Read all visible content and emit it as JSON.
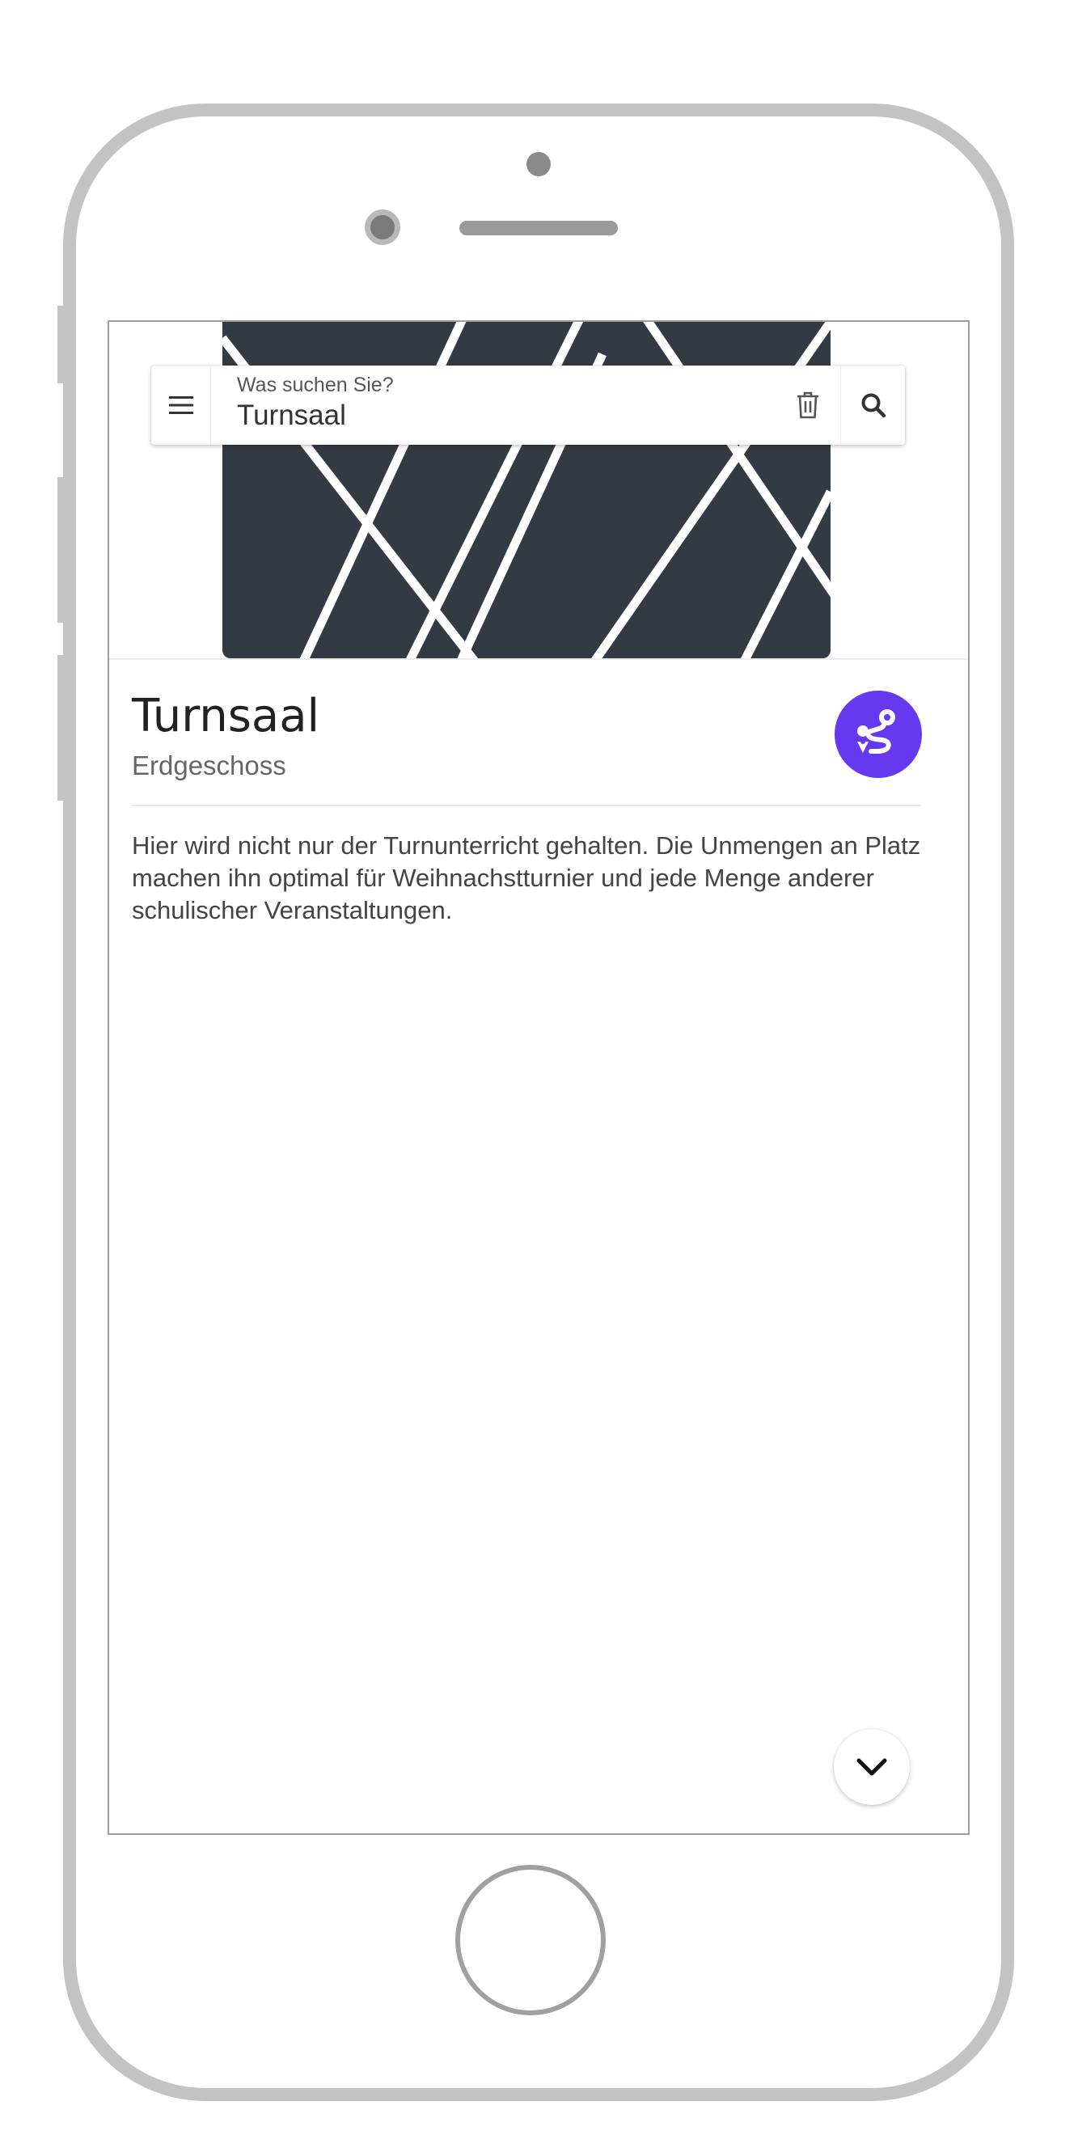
{
  "search": {
    "label": "Was suchen Sie?",
    "value": "Turnsaal"
  },
  "icons": {
    "menu": "menu-icon",
    "clear": "trash-icon",
    "search": "search-icon",
    "route": "route-icon",
    "collapse": "chevron-down-icon"
  },
  "room": {
    "title": "Turnsaal",
    "floor": "Erdgeschoss",
    "description": "Hier wird nicht nur der Turnunterricht gehalten. Die Unmengen an Platz machen ihn optimal für Weihnachstturnier und jede Menge anderer schulischer Veranstaltungen."
  },
  "colors": {
    "accent": "#6639f0",
    "hero_background": "#333a43",
    "frame": "#c3c3c3"
  }
}
